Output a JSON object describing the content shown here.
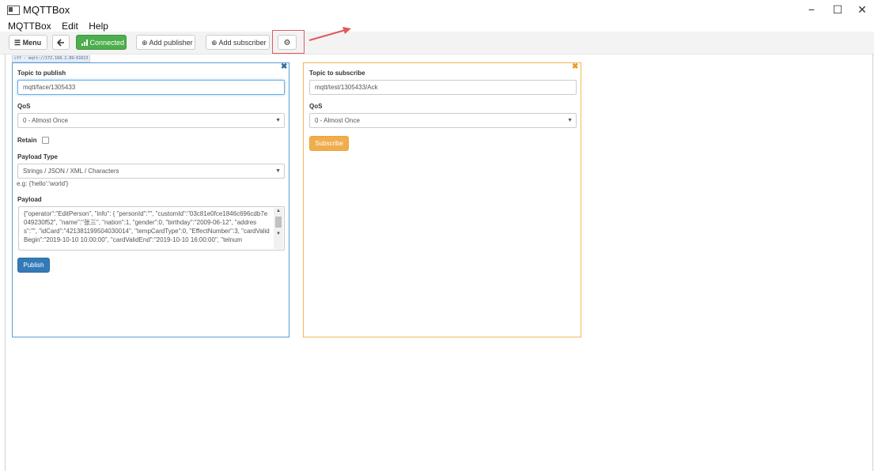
{
  "window": {
    "title": "MQTTBox",
    "minimize": "−",
    "maximize": "☐",
    "close": "✕"
  },
  "menu": [
    "MQTTBox",
    "Edit",
    "Help"
  ],
  "toolbar": {
    "menu_label": "☰ Menu",
    "back_label": "🡐",
    "connected_label": "Connected",
    "connected_icon": "signal-bars-icon",
    "add_publisher_label": "⊕ Add publisher",
    "add_subscriber_label": "⊕ Add subscriber",
    "settings_icon": "gear-icon",
    "settings_glyph": "⚙"
  },
  "connection_url": "cff - mqtt://172.168.2.89:61613",
  "publisher": {
    "close_glyph": "✖",
    "topic_label": "Topic to publish",
    "topic_value": "mqtt/face/1305433",
    "qos_label": "QoS",
    "qos_value": "0 - Almost Once",
    "retain_label": "Retain",
    "payload_type_label": "Payload Type",
    "payload_type_value": "Strings / JSON / XML / Characters",
    "payload_hint": "e.g: {'hello':'world'}",
    "payload_label": "Payload",
    "payload_value": "{\"operator\":\"EditPerson\", \"info\": { \"personId\":\"\", \"customId\":\"03c81e0fce1846c696cdb7e049230f52\", \"name\":\"张三\", \"nation\":1, \"gender\":0, \"birthday\":\"2009-06-12\", \"address\":\"\", \"idCard\":\"421381199504030014\", \"tempCardType\":0, \"EffectNumber\":3, \"cardValidBegin\":\"2019-10-10 10:00:00\", \"cardValidEnd\":\"2019-10-10 16:00:00\", \"telnum",
    "publish_label": "Publish"
  },
  "subscriber": {
    "close_glyph": "✖",
    "topic_label": "Topic to subscribe",
    "topic_value": "mqtt/test/1305433/Ack",
    "qos_label": "QoS",
    "qos_value": "0 - Almost Once",
    "subscribe_label": "Subscribe"
  },
  "colors": {
    "connected": "#4cae4c",
    "publish": "#337ab7",
    "subscribe": "#f0ad4e",
    "annotation_red": "#e05a5a"
  }
}
